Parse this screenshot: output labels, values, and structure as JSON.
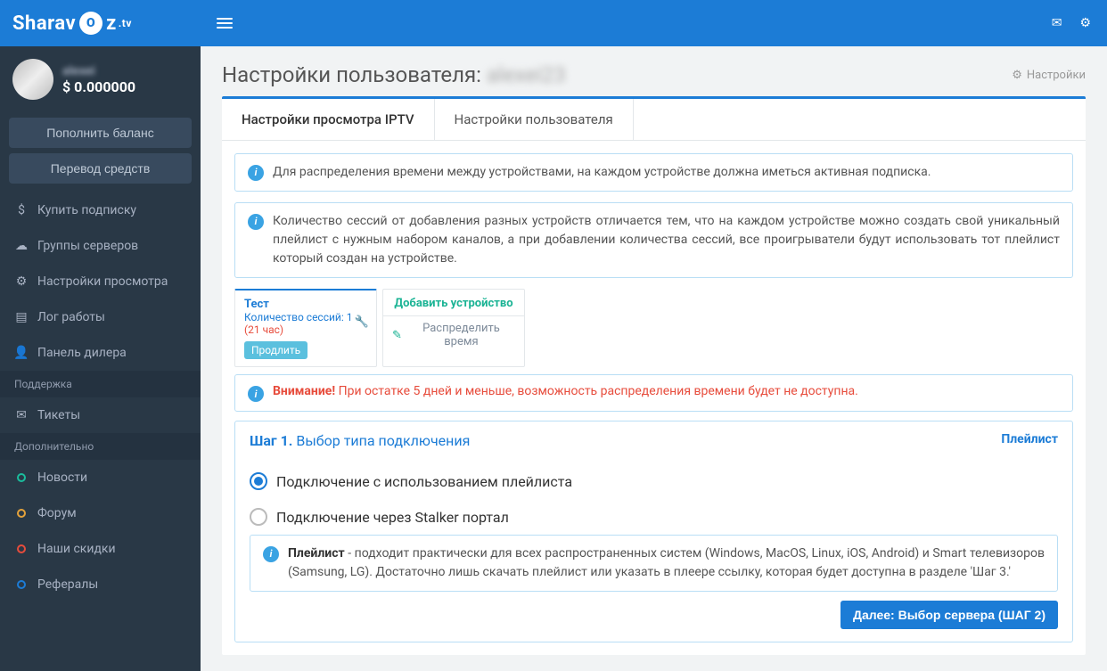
{
  "brand": "Sharavoz.tv",
  "user": {
    "name": "alexei",
    "balance": "$ 0.000000"
  },
  "sidebarButtons": {
    "topup": "Пополнить баланс",
    "transfer": "Перевод средств"
  },
  "nav": {
    "buy": "Купить подписку",
    "groups": "Группы серверов",
    "settings": "Настройки просмотра",
    "log": "Лог работы",
    "dealer": "Панель дилера",
    "sectionSupport": "Поддержка",
    "tickets": "Тикеты",
    "sectionExtra": "Дополнительно",
    "news": "Новости",
    "forum": "Форум",
    "discounts": "Наши скидки",
    "referrals": "Рефералы"
  },
  "page": {
    "titlePrefix": "Настройки пользователя:",
    "titleName": "alexei23",
    "breadcrumb": "Настройки"
  },
  "tabs": {
    "iptv": "Настройки просмотра IPTV",
    "user": "Настройки пользователя"
  },
  "info1": "Для распределения времени между устройствами, на каждом устройстве должна иметься активная подписка.",
  "info2": "Количество сессий от добавления разных устройств отличается тем, что на каждом устройстве можно создать свой уникальный плейлист с нужным набором каналов, а при добавлении количества сессий, все проигрыватели будут использовать тот плейлист который создан на устройстве.",
  "device": {
    "title": "Тест",
    "sessions": "Количество сессий: 1",
    "time": "(21 час)",
    "prolong": "Продлить",
    "add": "Добавить устройство",
    "dist": "Распределить время"
  },
  "warning": {
    "label": "Внимание!",
    "text": "При остатке 5 дней и меньше, возможность распределения времени будет не доступна."
  },
  "step": {
    "head": "Шаг 1.",
    "title": "Выбор типа подключения",
    "badge": "Плейлист",
    "opt1": "Подключение с использованием плейлиста",
    "opt2": "Подключение через Stalker портал",
    "descLabel": "Плейлист",
    "desc": " - подходит практически для всех распространенных систем (Windows, MacOS, Linux, iOS, Android) и Smart телевизоров (Samsung, LG). Достаточно лишь скачать плейлист или указать в плеере ссылку, которая будет доступна в разделе 'Шаг 3.'",
    "next": "Далее: Выбор сервера (ШАГ 2)"
  }
}
